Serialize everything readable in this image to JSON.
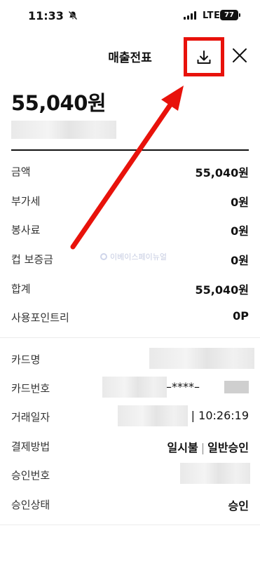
{
  "status_bar": {
    "time": "11:33",
    "network": "LTE",
    "battery": "77"
  },
  "header": {
    "title": "매출전표",
    "download_icon": "download-icon",
    "close_icon": "close-icon"
  },
  "summary": {
    "total_amount": "55,040원"
  },
  "amount_rows": [
    {
      "label": "금액",
      "value": "55,040원"
    },
    {
      "label": "부가세",
      "value": "0원"
    },
    {
      "label": "봉사료",
      "value": "0원"
    },
    {
      "label": "컵 보증금",
      "value": "0원"
    },
    {
      "label": "합계",
      "value": "55,040원"
    },
    {
      "label": "사용포인트리",
      "value": "0P"
    }
  ],
  "card_rows": {
    "card_name_label": "카드명",
    "card_number_label": "카드번호",
    "card_number_visible": "**–****–",
    "date_label": "거래일자",
    "time_value": "| 10:26:19",
    "method_label": "결제방법",
    "method_value_1": "일시불",
    "method_value_2": "일반승인",
    "approval_no_label": "승인번호",
    "status_label": "승인상태",
    "status_value": "승인"
  },
  "watermark": {
    "text": "이베이스페이뉴얼"
  },
  "annotation": {
    "highlight_color": "#e8120b"
  }
}
